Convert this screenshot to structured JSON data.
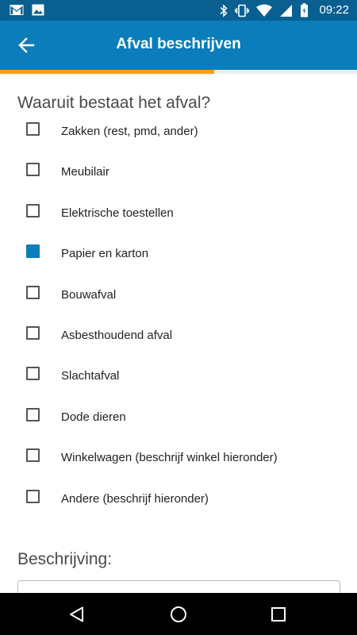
{
  "status_bar": {
    "time": "09:22",
    "left_icons": [
      "gmail-icon",
      "image-icon"
    ],
    "right_icons": [
      "bluetooth-icon",
      "vibrate-icon",
      "wifi-icon",
      "cellular-icon",
      "battery-icon"
    ]
  },
  "app_bar": {
    "title": "Afval beschrijven",
    "back_icon": "arrow-left-icon"
  },
  "progress": {
    "fraction": 0.6,
    "color": "#f5a01a"
  },
  "question": {
    "title": "Waaruit bestaat het afval?",
    "options": [
      {
        "label": "Zakken (rest, pmd, ander)",
        "checked": false
      },
      {
        "label": "Meubilair",
        "checked": false
      },
      {
        "label": "Elektrische toestellen",
        "checked": false
      },
      {
        "label": "Papier en karton",
        "checked": true
      },
      {
        "label": "Bouwafval",
        "checked": false
      },
      {
        "label": "Asbesthoudend afval",
        "checked": false
      },
      {
        "label": "Slachtafval",
        "checked": false
      },
      {
        "label": "Dode dieren",
        "checked": false
      },
      {
        "label": "Winkelwagen (beschrijf winkel hieronder)",
        "checked": false
      },
      {
        "label": "Andere (beschrijf hieronder)",
        "checked": false
      }
    ]
  },
  "description": {
    "title": "Beschrijving:",
    "value": ""
  },
  "nav_bar": {
    "buttons": [
      "back-triangle-icon",
      "home-circle-icon",
      "recents-square-icon"
    ]
  },
  "colors": {
    "status_bar": "#0a5f91",
    "app_bar": "#0a7dba",
    "accent": "#0a7dba",
    "progress": "#f5a01a"
  }
}
